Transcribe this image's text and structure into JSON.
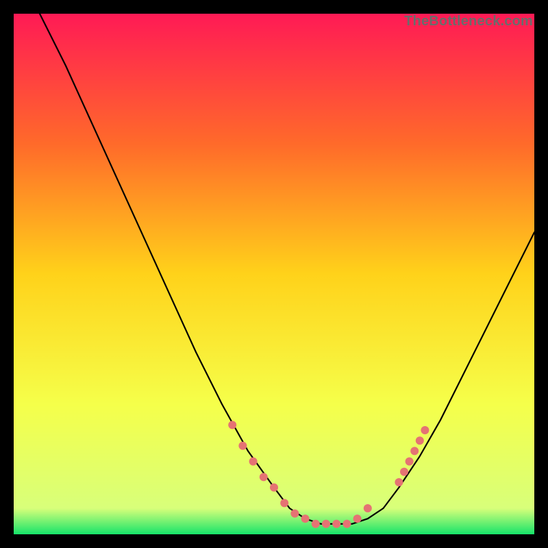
{
  "watermark": "TheBottleneck.com",
  "chart_data": {
    "type": "line",
    "title": "",
    "xlabel": "",
    "ylabel": "",
    "xlim": [
      0,
      100
    ],
    "ylim": [
      0,
      100
    ],
    "background_gradient": {
      "stops": [
        {
          "offset": 0.0,
          "color": "#ff1a55"
        },
        {
          "offset": 0.25,
          "color": "#ff6a2a"
        },
        {
          "offset": 0.5,
          "color": "#ffd21a"
        },
        {
          "offset": 0.75,
          "color": "#f5ff4a"
        },
        {
          "offset": 0.95,
          "color": "#d8ff7a"
        },
        {
          "offset": 1.0,
          "color": "#16e46a"
        }
      ]
    },
    "series": [
      {
        "name": "bottleneck-curve",
        "x": [
          5,
          10,
          15,
          20,
          25,
          30,
          35,
          40,
          45,
          50,
          53,
          56,
          59,
          62,
          65,
          68,
          71,
          74,
          78,
          82,
          86,
          90,
          94,
          98,
          100
        ],
        "y": [
          100,
          90,
          79,
          68,
          57,
          46,
          35,
          25,
          16,
          9,
          5,
          3,
          2,
          2,
          2,
          3,
          5,
          9,
          15,
          22,
          30,
          38,
          46,
          54,
          58
        ],
        "stroke": "#000000",
        "stroke_width": 2.2
      }
    ],
    "overlay_markers": {
      "name": "highlight-beads",
      "color": "#e57373",
      "radius": 6,
      "points": [
        {
          "x": 42,
          "y": 21
        },
        {
          "x": 44,
          "y": 17
        },
        {
          "x": 46,
          "y": 14
        },
        {
          "x": 48,
          "y": 11
        },
        {
          "x": 50,
          "y": 9
        },
        {
          "x": 52,
          "y": 6
        },
        {
          "x": 54,
          "y": 4
        },
        {
          "x": 56,
          "y": 3
        },
        {
          "x": 58,
          "y": 2
        },
        {
          "x": 60,
          "y": 2
        },
        {
          "x": 62,
          "y": 2
        },
        {
          "x": 64,
          "y": 2
        },
        {
          "x": 66,
          "y": 3
        },
        {
          "x": 68,
          "y": 5
        },
        {
          "x": 74,
          "y": 10
        },
        {
          "x": 75,
          "y": 12
        },
        {
          "x": 76,
          "y": 14
        },
        {
          "x": 77,
          "y": 16
        },
        {
          "x": 78,
          "y": 18
        },
        {
          "x": 79,
          "y": 20
        }
      ]
    }
  }
}
